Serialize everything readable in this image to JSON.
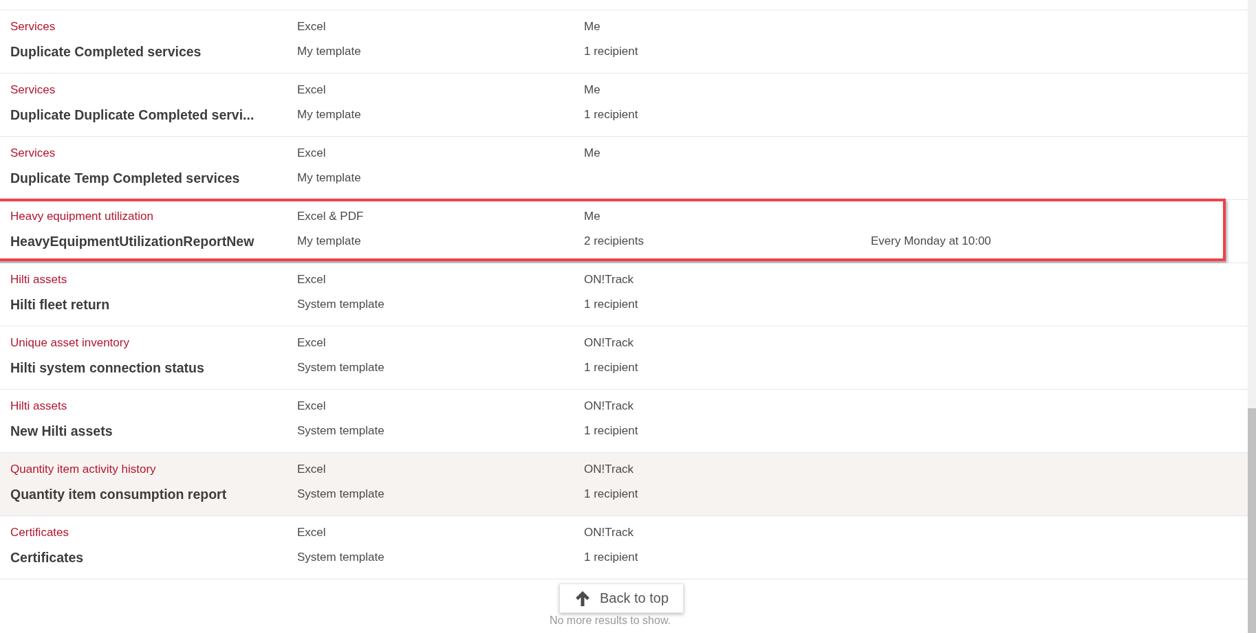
{
  "reports": [
    {
      "category": "Services",
      "title": "Duplicate Completed services",
      "format": "Excel",
      "template": "My template",
      "owner": "Me",
      "recipients": "1 recipient",
      "hovered": false,
      "annotated": false
    },
    {
      "category": "Services",
      "title": "Duplicate Duplicate Completed servi...",
      "format": "Excel",
      "template": "My template",
      "owner": "Me",
      "recipients": "1 recipient",
      "hovered": false,
      "annotated": false
    },
    {
      "category": "Services",
      "title": "Duplicate Temp Completed services",
      "format": "Excel",
      "template": "My template",
      "owner": "Me",
      "hovered": false,
      "annotated": false
    },
    {
      "category": "Heavy equipment utilization",
      "title": "HeavyEquipmentUtilizationReportNew",
      "format": "Excel & PDF",
      "template": "My template",
      "owner": "Me",
      "recipients": "2 recipients",
      "schedule": "Every Monday at 10:00",
      "hovered": false,
      "annotated": true
    },
    {
      "category": "Hilti assets",
      "title": "Hilti fleet return",
      "format": "Excel",
      "template": "System template",
      "owner": "ON!Track",
      "recipients": "1 recipient",
      "hovered": false,
      "annotated": false
    },
    {
      "category": "Unique asset inventory",
      "title": "Hilti system connection status",
      "format": "Excel",
      "template": "System template",
      "owner": "ON!Track",
      "recipients": "1 recipient",
      "hovered": false,
      "annotated": false
    },
    {
      "category": "Hilti assets",
      "title": "New Hilti assets",
      "format": "Excel",
      "template": "System template",
      "owner": "ON!Track",
      "recipients": "1 recipient",
      "hovered": false,
      "annotated": false
    },
    {
      "category": "Quantity item activity history",
      "title": "Quantity item consumption report",
      "format": "Excel",
      "template": "System template",
      "owner": "ON!Track",
      "recipients": "1 recipient",
      "hovered": true,
      "annotated": false
    },
    {
      "category": "Certificates",
      "title": "Certificates",
      "format": "Excel",
      "template": "System template",
      "owner": "ON!Track",
      "recipients": "1 recipient",
      "hovered": false,
      "annotated": false
    }
  ],
  "footer": {
    "message": "No more results to show.",
    "back_to_top": "Back to top"
  }
}
